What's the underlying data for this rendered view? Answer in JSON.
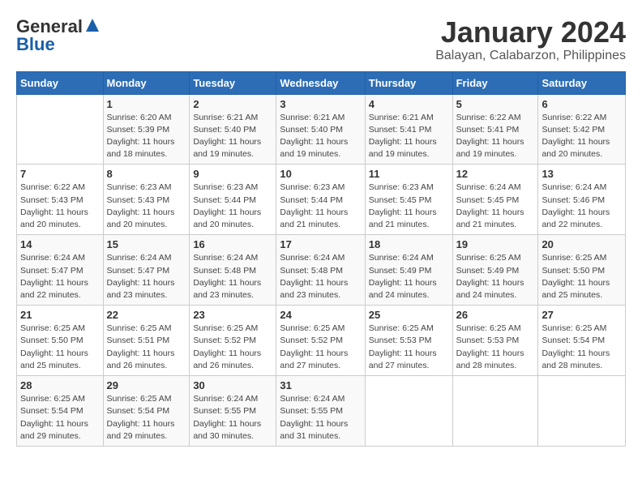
{
  "header": {
    "logo_general": "General",
    "logo_blue": "Blue",
    "month_title": "January 2024",
    "location": "Balayan, Calabarzon, Philippines"
  },
  "days_of_week": [
    "Sunday",
    "Monday",
    "Tuesday",
    "Wednesday",
    "Thursday",
    "Friday",
    "Saturday"
  ],
  "weeks": [
    [
      {
        "day": "",
        "sunrise": "",
        "sunset": "",
        "daylight": ""
      },
      {
        "day": "1",
        "sunrise": "Sunrise: 6:20 AM",
        "sunset": "Sunset: 5:39 PM",
        "daylight": "Daylight: 11 hours and 18 minutes."
      },
      {
        "day": "2",
        "sunrise": "Sunrise: 6:21 AM",
        "sunset": "Sunset: 5:40 PM",
        "daylight": "Daylight: 11 hours and 19 minutes."
      },
      {
        "day": "3",
        "sunrise": "Sunrise: 6:21 AM",
        "sunset": "Sunset: 5:40 PM",
        "daylight": "Daylight: 11 hours and 19 minutes."
      },
      {
        "day": "4",
        "sunrise": "Sunrise: 6:21 AM",
        "sunset": "Sunset: 5:41 PM",
        "daylight": "Daylight: 11 hours and 19 minutes."
      },
      {
        "day": "5",
        "sunrise": "Sunrise: 6:22 AM",
        "sunset": "Sunset: 5:41 PM",
        "daylight": "Daylight: 11 hours and 19 minutes."
      },
      {
        "day": "6",
        "sunrise": "Sunrise: 6:22 AM",
        "sunset": "Sunset: 5:42 PM",
        "daylight": "Daylight: 11 hours and 20 minutes."
      }
    ],
    [
      {
        "day": "7",
        "sunrise": "Sunrise: 6:22 AM",
        "sunset": "Sunset: 5:43 PM",
        "daylight": "Daylight: 11 hours and 20 minutes."
      },
      {
        "day": "8",
        "sunrise": "Sunrise: 6:23 AM",
        "sunset": "Sunset: 5:43 PM",
        "daylight": "Daylight: 11 hours and 20 minutes."
      },
      {
        "day": "9",
        "sunrise": "Sunrise: 6:23 AM",
        "sunset": "Sunset: 5:44 PM",
        "daylight": "Daylight: 11 hours and 20 minutes."
      },
      {
        "day": "10",
        "sunrise": "Sunrise: 6:23 AM",
        "sunset": "Sunset: 5:44 PM",
        "daylight": "Daylight: 11 hours and 21 minutes."
      },
      {
        "day": "11",
        "sunrise": "Sunrise: 6:23 AM",
        "sunset": "Sunset: 5:45 PM",
        "daylight": "Daylight: 11 hours and 21 minutes."
      },
      {
        "day": "12",
        "sunrise": "Sunrise: 6:24 AM",
        "sunset": "Sunset: 5:45 PM",
        "daylight": "Daylight: 11 hours and 21 minutes."
      },
      {
        "day": "13",
        "sunrise": "Sunrise: 6:24 AM",
        "sunset": "Sunset: 5:46 PM",
        "daylight": "Daylight: 11 hours and 22 minutes."
      }
    ],
    [
      {
        "day": "14",
        "sunrise": "Sunrise: 6:24 AM",
        "sunset": "Sunset: 5:47 PM",
        "daylight": "Daylight: 11 hours and 22 minutes."
      },
      {
        "day": "15",
        "sunrise": "Sunrise: 6:24 AM",
        "sunset": "Sunset: 5:47 PM",
        "daylight": "Daylight: 11 hours and 23 minutes."
      },
      {
        "day": "16",
        "sunrise": "Sunrise: 6:24 AM",
        "sunset": "Sunset: 5:48 PM",
        "daylight": "Daylight: 11 hours and 23 minutes."
      },
      {
        "day": "17",
        "sunrise": "Sunrise: 6:24 AM",
        "sunset": "Sunset: 5:48 PM",
        "daylight": "Daylight: 11 hours and 23 minutes."
      },
      {
        "day": "18",
        "sunrise": "Sunrise: 6:24 AM",
        "sunset": "Sunset: 5:49 PM",
        "daylight": "Daylight: 11 hours and 24 minutes."
      },
      {
        "day": "19",
        "sunrise": "Sunrise: 6:25 AM",
        "sunset": "Sunset: 5:49 PM",
        "daylight": "Daylight: 11 hours and 24 minutes."
      },
      {
        "day": "20",
        "sunrise": "Sunrise: 6:25 AM",
        "sunset": "Sunset: 5:50 PM",
        "daylight": "Daylight: 11 hours and 25 minutes."
      }
    ],
    [
      {
        "day": "21",
        "sunrise": "Sunrise: 6:25 AM",
        "sunset": "Sunset: 5:50 PM",
        "daylight": "Daylight: 11 hours and 25 minutes."
      },
      {
        "day": "22",
        "sunrise": "Sunrise: 6:25 AM",
        "sunset": "Sunset: 5:51 PM",
        "daylight": "Daylight: 11 hours and 26 minutes."
      },
      {
        "day": "23",
        "sunrise": "Sunrise: 6:25 AM",
        "sunset": "Sunset: 5:52 PM",
        "daylight": "Daylight: 11 hours and 26 minutes."
      },
      {
        "day": "24",
        "sunrise": "Sunrise: 6:25 AM",
        "sunset": "Sunset: 5:52 PM",
        "daylight": "Daylight: 11 hours and 27 minutes."
      },
      {
        "day": "25",
        "sunrise": "Sunrise: 6:25 AM",
        "sunset": "Sunset: 5:53 PM",
        "daylight": "Daylight: 11 hours and 27 minutes."
      },
      {
        "day": "26",
        "sunrise": "Sunrise: 6:25 AM",
        "sunset": "Sunset: 5:53 PM",
        "daylight": "Daylight: 11 hours and 28 minutes."
      },
      {
        "day": "27",
        "sunrise": "Sunrise: 6:25 AM",
        "sunset": "Sunset: 5:54 PM",
        "daylight": "Daylight: 11 hours and 28 minutes."
      }
    ],
    [
      {
        "day": "28",
        "sunrise": "Sunrise: 6:25 AM",
        "sunset": "Sunset: 5:54 PM",
        "daylight": "Daylight: 11 hours and 29 minutes."
      },
      {
        "day": "29",
        "sunrise": "Sunrise: 6:25 AM",
        "sunset": "Sunset: 5:54 PM",
        "daylight": "Daylight: 11 hours and 29 minutes."
      },
      {
        "day": "30",
        "sunrise": "Sunrise: 6:24 AM",
        "sunset": "Sunset: 5:55 PM",
        "daylight": "Daylight: 11 hours and 30 minutes."
      },
      {
        "day": "31",
        "sunrise": "Sunrise: 6:24 AM",
        "sunset": "Sunset: 5:55 PM",
        "daylight": "Daylight: 11 hours and 31 minutes."
      },
      {
        "day": "",
        "sunrise": "",
        "sunset": "",
        "daylight": ""
      },
      {
        "day": "",
        "sunrise": "",
        "sunset": "",
        "daylight": ""
      },
      {
        "day": "",
        "sunrise": "",
        "sunset": "",
        "daylight": ""
      }
    ]
  ]
}
